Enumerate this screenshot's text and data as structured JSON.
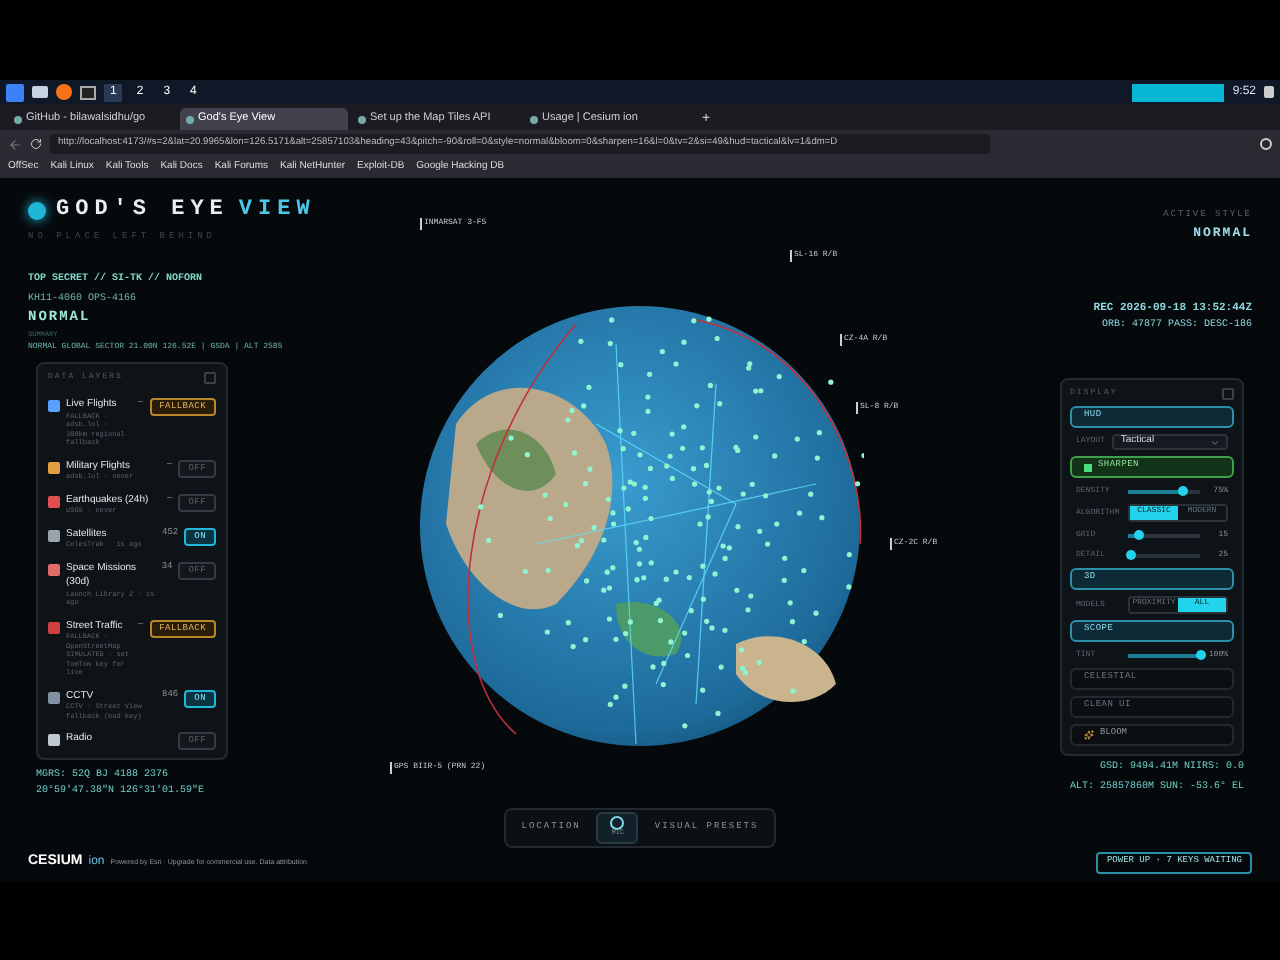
{
  "taskbar": {
    "workspaces": [
      {
        "label": "1",
        "selected": true
      },
      {
        "label": "2",
        "selected": false
      },
      {
        "label": "3",
        "selected": false
      },
      {
        "label": "4",
        "selected": false
      }
    ],
    "clock": "9:52"
  },
  "tabs": [
    {
      "title": "GitHub - bilawalsidhu/go",
      "selected": false
    },
    {
      "title": "God's Eye View",
      "selected": true
    },
    {
      "title": "Set up the Map Tiles API",
      "selected": false
    },
    {
      "title": "Usage | Cesium ion",
      "selected": false
    }
  ],
  "new_tab": "+",
  "url": "http://localhost:4173/#s=2&lat=20.9965&lon=126.5171&alt=25857103&heading=43&pitch=-90&roll=0&style=normal&bloom=0&sharpen=16&l=0&tv=2&si=49&hud=tactical&lv=1&dm=D",
  "bookmarks": [
    "OffSec",
    "Kali Linux",
    "Kali Tools",
    "Kali Docs",
    "Kali Forums",
    "Kali NetHunter",
    "Exploit-DB",
    "Google Hacking DB"
  ],
  "header": {
    "title": "GOD'S EYE",
    "title_accent": "VIEW",
    "tagline": "NO PLACE LEFT BEHIND",
    "style_label": "ACTIVE STYLE",
    "style_value": "NORMAL"
  },
  "classification": {
    "banner": "TOP SECRET // SI-TK // NOFORN",
    "designator": "KH11-4060 OPS-4166",
    "mode": "NORMAL",
    "summary_label": "SUMMARY",
    "summary": "NORMAL GLOBAL SECTOR 21.00N 126.52E | GSDA | ALT 2585"
  },
  "recording": {
    "timestamp": "REC 2026-09-18 13:52:44Z",
    "orbit": "ORB: 47877 PASS: DESC-186"
  },
  "data_layers": {
    "title": "DATA LAYERS",
    "items": [
      {
        "name": "Live Flights",
        "source": "FALLBACK · adsb.lol · 300km regional fallback",
        "count": "—",
        "kind": "fallback",
        "label": "FALLBACK"
      },
      {
        "name": "Military Flights",
        "source": "adsb.lol · never",
        "count": "—",
        "kind": "off",
        "label": "OFF"
      },
      {
        "name": "Earthquakes (24h)",
        "source": "USGS · never",
        "count": "—",
        "kind": "off",
        "label": "OFF"
      },
      {
        "name": "Satellites",
        "source": "CelesTrak · 1s ago",
        "count": "452",
        "kind": "on",
        "label": "ON"
      },
      {
        "name": "Space Missions (30d)",
        "source": "Launch Library 2 · 1s ago",
        "count": "34",
        "kind": "off",
        "label": "OFF"
      },
      {
        "name": "Street Traffic",
        "source": "FALLBACK · OpenStreetMap SIMULATED · set TomTom key for live",
        "count": "—",
        "kind": "fallback",
        "label": "FALLBACK"
      },
      {
        "name": "CCTV",
        "source": "CCTV · Street View fallback (bad key)",
        "count": "846",
        "kind": "on",
        "label": "ON"
      },
      {
        "name": "Radio",
        "kind": "off",
        "label": "OFF"
      }
    ]
  },
  "coordinates": {
    "mgrs": "MGRS: 52Q BJ 4188 2376",
    "latlon": "20°59'47.38\"N 126°31'01.59\"E"
  },
  "telemetry": [
    "GSD: 9494.41M NIIRS: 0.0",
    "ALT: 25857860M SUN: -53.6° EL"
  ],
  "display": {
    "title": "DISPLAY",
    "rows": [
      {
        "kind": "section",
        "label": "HUD",
        "on": true
      },
      {
        "kind": "select",
        "label": "LAYOUT",
        "value": "Tactical"
      },
      {
        "kind": "check_section",
        "label": "SHARPEN",
        "checked": true
      },
      {
        "kind": "slider",
        "label": "DENSITY",
        "level": 0.75,
        "reading": "75%"
      },
      {
        "kind": "segmented",
        "label": "ALGORITHM",
        "options": [
          {
            "label": "CLASSIC",
            "selected": true
          },
          {
            "label": "MODERN",
            "selected": false
          }
        ]
      },
      {
        "kind": "slider",
        "label": "GRID",
        "level": 0.15,
        "reading": "15"
      },
      {
        "kind": "slider",
        "label": "DETAIL",
        "level": 0.05,
        "reading": "25"
      },
      {
        "kind": "section",
        "label": "3D",
        "on": true
      },
      {
        "kind": "segmented",
        "label": "MODELS",
        "options": [
          {
            "label": "PROXIMITY",
            "selected": false
          },
          {
            "label": "ALL",
            "selected": true
          }
        ]
      },
      {
        "kind": "section",
        "label": "SCOPE",
        "on": true
      },
      {
        "kind": "slider",
        "label": "TINT",
        "level": 1,
        "reading": "100%"
      },
      {
        "kind": "section",
        "label": "CELESTIAL",
        "on": false
      },
      {
        "kind": "section",
        "label": "CLEAN UI",
        "on": false
      },
      {
        "kind": "action",
        "label": "BLOOM"
      }
    ]
  },
  "globe": {
    "satellite_labels": [
      "INMARSAT 3-F5",
      "SL-16 R/B",
      "CZ-4A R/B",
      "SL-8 R/B",
      "CZ-2C R/B",
      "GPS BIIR-5 (PRN 22)"
    ]
  },
  "bottom_bar": {
    "location": "LOCATION",
    "mic": "MIC",
    "presets": "VISUAL PRESETS"
  },
  "footer": {
    "logo": "CESIUM",
    "logo_suffix": "ion",
    "attribution": "Powered by Esri · Upgrade for commercial use. Data attribution",
    "power_up": "POWER UP · 7 KEYS WAITING"
  }
}
